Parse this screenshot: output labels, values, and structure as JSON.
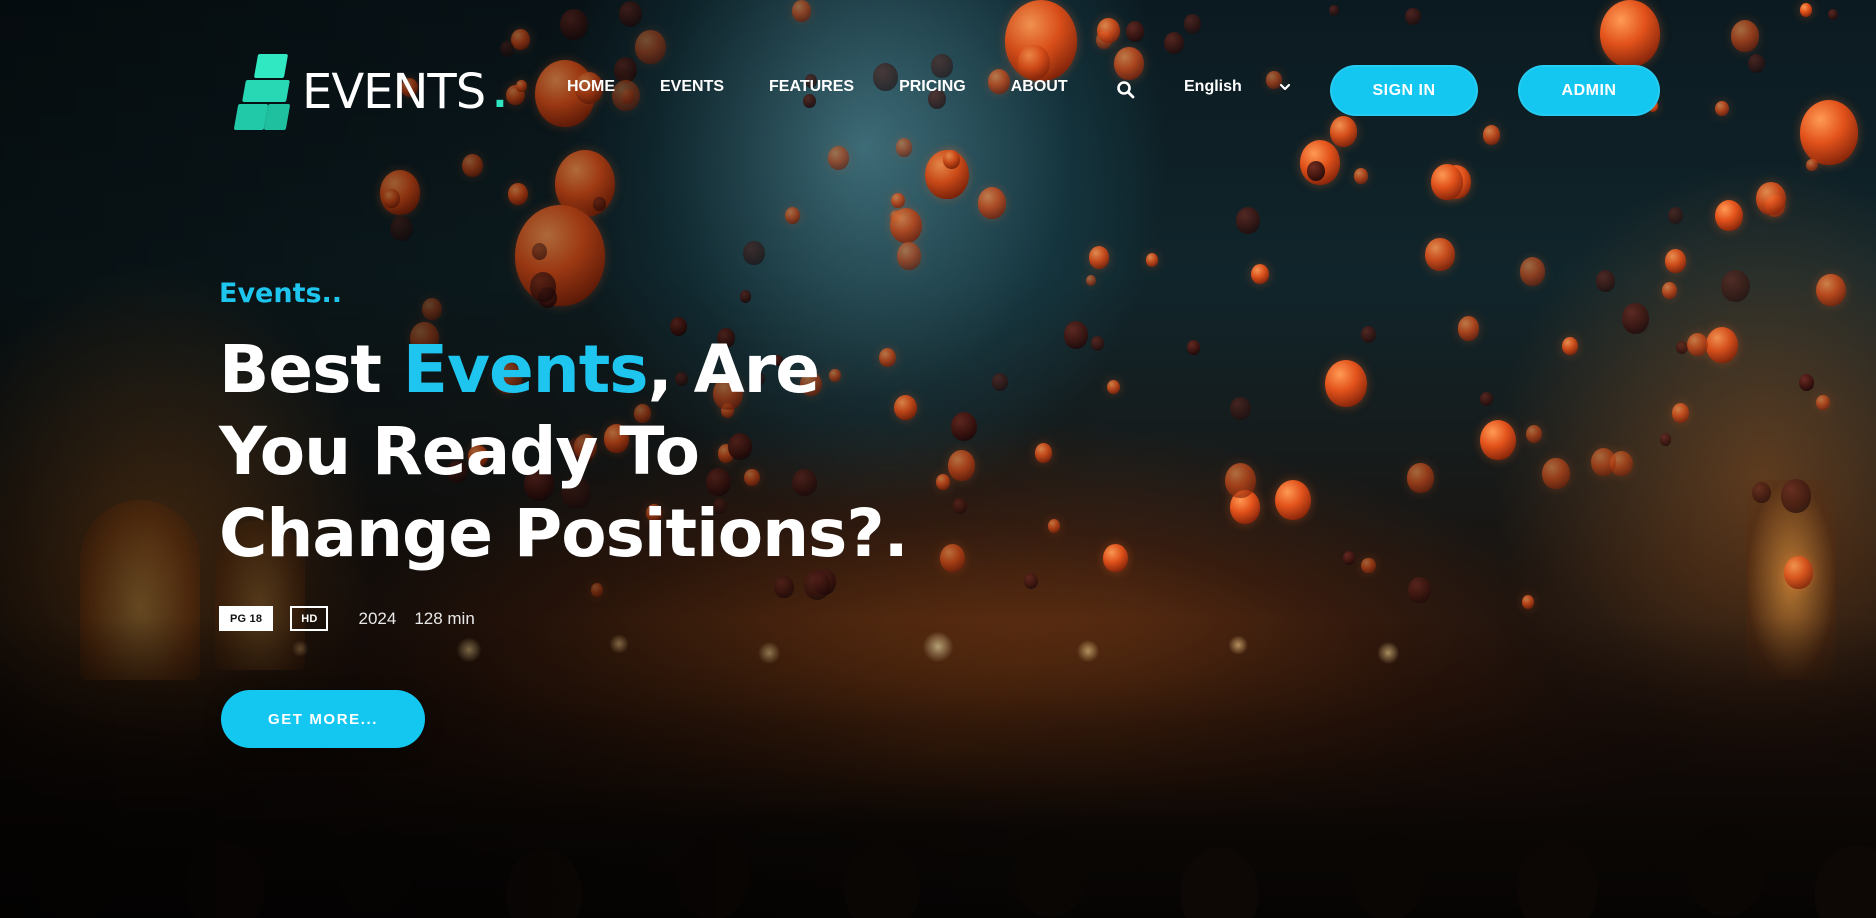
{
  "brand": {
    "logo_text": "EVENTS",
    "logo_dot": ".",
    "accent_color": "#14c7f0",
    "logo_color": "#2ee6c0"
  },
  "nav": {
    "items": [
      {
        "label": "HOME"
      },
      {
        "label": "EVENTS"
      },
      {
        "label": "FEATURES"
      },
      {
        "label": "PRICING"
      },
      {
        "label": "ABOUT"
      }
    ],
    "search_icon": "search-icon",
    "language": {
      "selected": "English",
      "icon": "chevron-down-icon"
    },
    "sign_in_label": "SIGN IN",
    "admin_label": "ADMIN"
  },
  "hero": {
    "eyebrow": "Events..",
    "headline": {
      "part1": "Best ",
      "accent": "Events",
      "part2": ", Are",
      "line2": "You Ready To",
      "line3": "Change Positions?."
    },
    "badges": {
      "rating": "PG 18",
      "quality": "HD"
    },
    "year": "2024",
    "duration": "128 min",
    "cta_label": "GET MORE..."
  }
}
